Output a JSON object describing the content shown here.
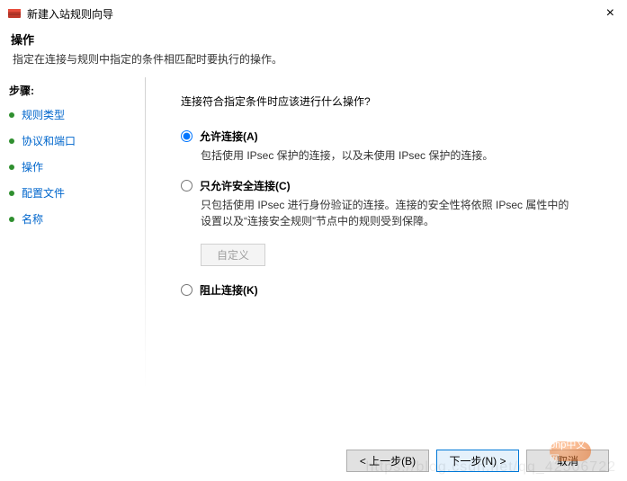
{
  "window": {
    "title": "新建入站规则向导"
  },
  "header": {
    "title": "操作",
    "description": "指定在连接与规则中指定的条件相匹配时要执行的操作。"
  },
  "sidebar": {
    "title": "步骤:",
    "steps": [
      {
        "label": "规则类型"
      },
      {
        "label": "协议和端口"
      },
      {
        "label": "操作"
      },
      {
        "label": "配置文件"
      },
      {
        "label": "名称"
      }
    ]
  },
  "main": {
    "prompt": "连接符合指定条件时应该进行什么操作?",
    "options": [
      {
        "label": "允许连接(A)",
        "description": "包括使用 IPsec 保护的连接，以及未使用 IPsec 保护的连接。",
        "selected": true
      },
      {
        "label": "只允许安全连接(C)",
        "description": "只包括使用 IPsec 进行身份验证的连接。连接的安全性将依照 IPsec 属性中的设置以及“连接安全规则”节点中的规则受到保障。",
        "selected": false
      },
      {
        "label": "阻止连接(K)",
        "description": "",
        "selected": false
      }
    ],
    "customize_button": "自定义"
  },
  "footer": {
    "back": "< 上一步(B)",
    "next": "下一步(N) >",
    "cancel": "取消"
  },
  "watermark": {
    "url": "https://blog.csdn.net/qq_42506722",
    "stamp": "php中文网"
  }
}
